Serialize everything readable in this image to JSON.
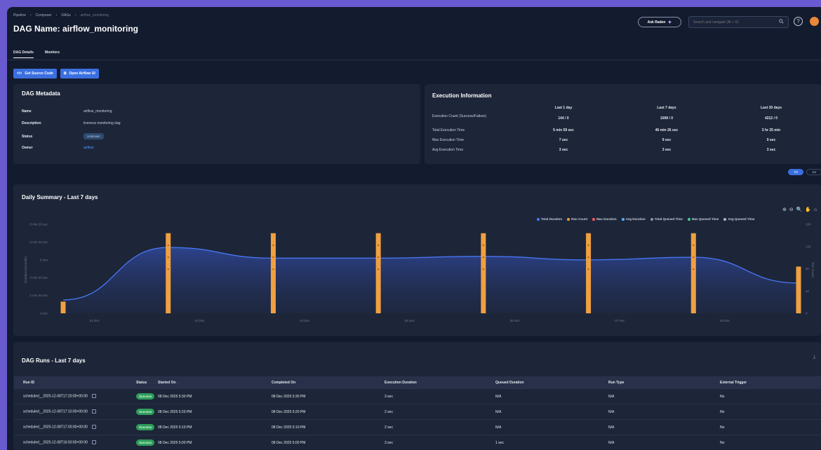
{
  "breadcrumb": [
    "Pipeline",
    "Composer",
    "DAGs",
    "airflow_monitoring"
  ],
  "title": "DAG Name: airflow_monitoring",
  "header": {
    "ask_label": "Ask Raden",
    "search_placeholder": "Search and navigate (⌘ + K)",
    "help": "?"
  },
  "tabs": [
    "DAG Details",
    "Monitors"
  ],
  "actions": {
    "source_code": "Get Source Code",
    "airflow_ui": "Open Airflow UI"
  },
  "metadata": {
    "title": "DAG Metadata",
    "rows": [
      {
        "key": "Name",
        "value": "airflow_monitoring"
      },
      {
        "key": "Description",
        "value": "liveness monitoring dag"
      },
      {
        "key": "Status",
        "value": "Unknown"
      },
      {
        "key": "Owner",
        "value": "airflow"
      }
    ]
  },
  "execution": {
    "title": "Execution Information",
    "columns": [
      "Last 1 day",
      "Last 7 days",
      "Last 30 days"
    ],
    "rows": [
      {
        "label": "Execution Count (Success/Failure)",
        "values": [
          "144 / 0",
          "1008 / 0",
          "4212 / 0"
        ]
      },
      {
        "label": "Total Execution Time",
        "values": [
          "5 min 59 sec",
          "46 min 26 sec",
          "3 hr 25 min"
        ]
      },
      {
        "label": "Max Execution Time",
        "values": [
          "7 sec",
          "9 sec",
          "9 sec"
        ]
      },
      {
        "label": "Avg Execution Time",
        "values": [
          "3 sec",
          "3 sec",
          "3 sec"
        ]
      }
    ]
  },
  "toggle": {
    "on": "7D",
    "off": "1M"
  },
  "chart_tools": "⊕ ⊖ 🔍 ✋ ⌂",
  "chart_data": {
    "type": "line",
    "title": "Daily Summary - Last 7 days",
    "legend": [
      {
        "name": "Total Duration",
        "color": "#4a7bff"
      },
      {
        "name": "Run Count",
        "color": "#f0a040"
      },
      {
        "name": "Max Duration",
        "color": "#ff5a5a"
      },
      {
        "name": "Avg Duration",
        "color": "#5ab0ff"
      },
      {
        "name": "Total Queued Time",
        "color": "#8a93ad"
      },
      {
        "name": "Max Queued Time",
        "color": "#3ed28a"
      },
      {
        "name": "Avg Queued Time",
        "color": "#b0b8c8"
      }
    ],
    "legend_position": "top-right",
    "ylabel": "Duration (seconds)",
    "y2label": "Run Count",
    "y_ticks": [
      "8 min 20 sec",
      "6 min 40 sec",
      "5 min",
      "3 min 20 sec",
      "1 min 40 sec",
      "0 sec"
    ],
    "y2_ticks": [
      "160",
      "120",
      "80",
      "40",
      "0"
    ],
    "x_ticks": [
      "02 Dec",
      "03 Dec",
      "04 Dec",
      "05 Dec",
      "06 Dec",
      "07 Dec",
      "08 Dec"
    ],
    "x": [
      0,
      1,
      2,
      3,
      4,
      5,
      6,
      7
    ],
    "series": [
      {
        "name": "Total Duration",
        "values": [
          75,
          370,
          310,
          310,
          320,
          300,
          315,
          170
        ]
      },
      {
        "name": "Run Count",
        "values": [
          21,
          144,
          144,
          144,
          144,
          144,
          144,
          84
        ]
      }
    ],
    "ylim": [
      0,
      500
    ],
    "y2lim": [
      0,
      160
    ]
  },
  "runs": {
    "title": "DAG Runs - Last 7 days",
    "columns": [
      "Run ID",
      "Status",
      "Started On",
      "Completed On",
      "Execution Duration",
      "Queued Duration",
      "Run Type",
      "External Trigger"
    ],
    "rows": [
      [
        "scheduled__2025-12-08T17:20:00+00:00",
        "Success",
        "08 Dec 2025 5:30 PM",
        "08 Dec 2025 5:30 PM",
        "3 sec",
        "N/A",
        "N/A",
        "No"
      ],
      [
        "scheduled__2025-12-08T17:10:00+00:00",
        "Success",
        "08 Dec 2025 5:20 PM",
        "08 Dec 2025 5:20 PM",
        "2 sec",
        "N/A",
        "N/A",
        "No"
      ],
      [
        "scheduled__2025-12-08T17:00:00+00:00",
        "Success",
        "08 Dec 2025 5:10 PM",
        "08 Dec 2025 5:10 PM",
        "2 sec",
        "N/A",
        "N/A",
        "No"
      ],
      [
        "scheduled__2025-12-08T16:50:00+00:00",
        "Success",
        "08 Dec 2025 5:00 PM",
        "08 Dec 2025 5:00 PM",
        "3 sec",
        "1 sec",
        "N/A",
        "No"
      ]
    ]
  }
}
